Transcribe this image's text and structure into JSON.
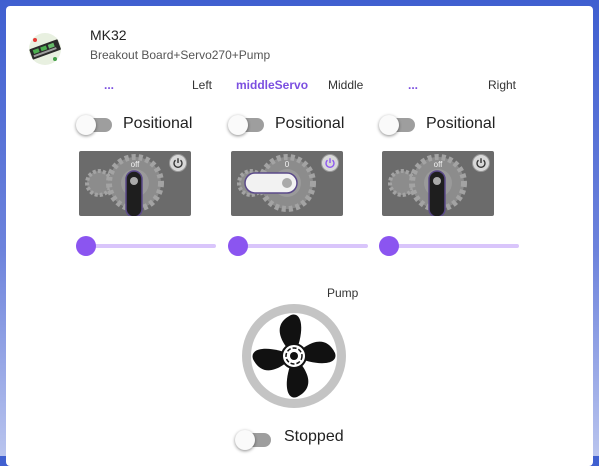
{
  "header": {
    "title": "MK32",
    "subtitle": "Breakout Board+Servo270+Pump",
    "image_icon": "breakout-board-icon"
  },
  "servos": [
    {
      "name": "...",
      "label": "Left",
      "mode_label": "Positional",
      "mode_on": false,
      "indicator": "off",
      "angle": "off",
      "power_icon": "power-icon",
      "slider_value": 0
    },
    {
      "name": "middleServo",
      "label": "Middle",
      "mode_label": "Positional",
      "mode_on": false,
      "indicator": "0",
      "angle": "0",
      "power_icon": "power-icon",
      "slider_value": 0
    },
    {
      "name": "...",
      "label": "Right",
      "mode_label": "Positional",
      "mode_on": false,
      "indicator": "off",
      "angle": "off",
      "power_icon": "power-icon",
      "slider_value": 0
    }
  ],
  "pump": {
    "label": "Pump",
    "state_label": "Stopped",
    "running": false,
    "icon": "propeller-icon"
  },
  "colors": {
    "accent": "#8b55f0",
    "slider_rail": "#d9c5fb",
    "servo_body": "#6b6b6b",
    "background_top": "#3f5fd0"
  }
}
